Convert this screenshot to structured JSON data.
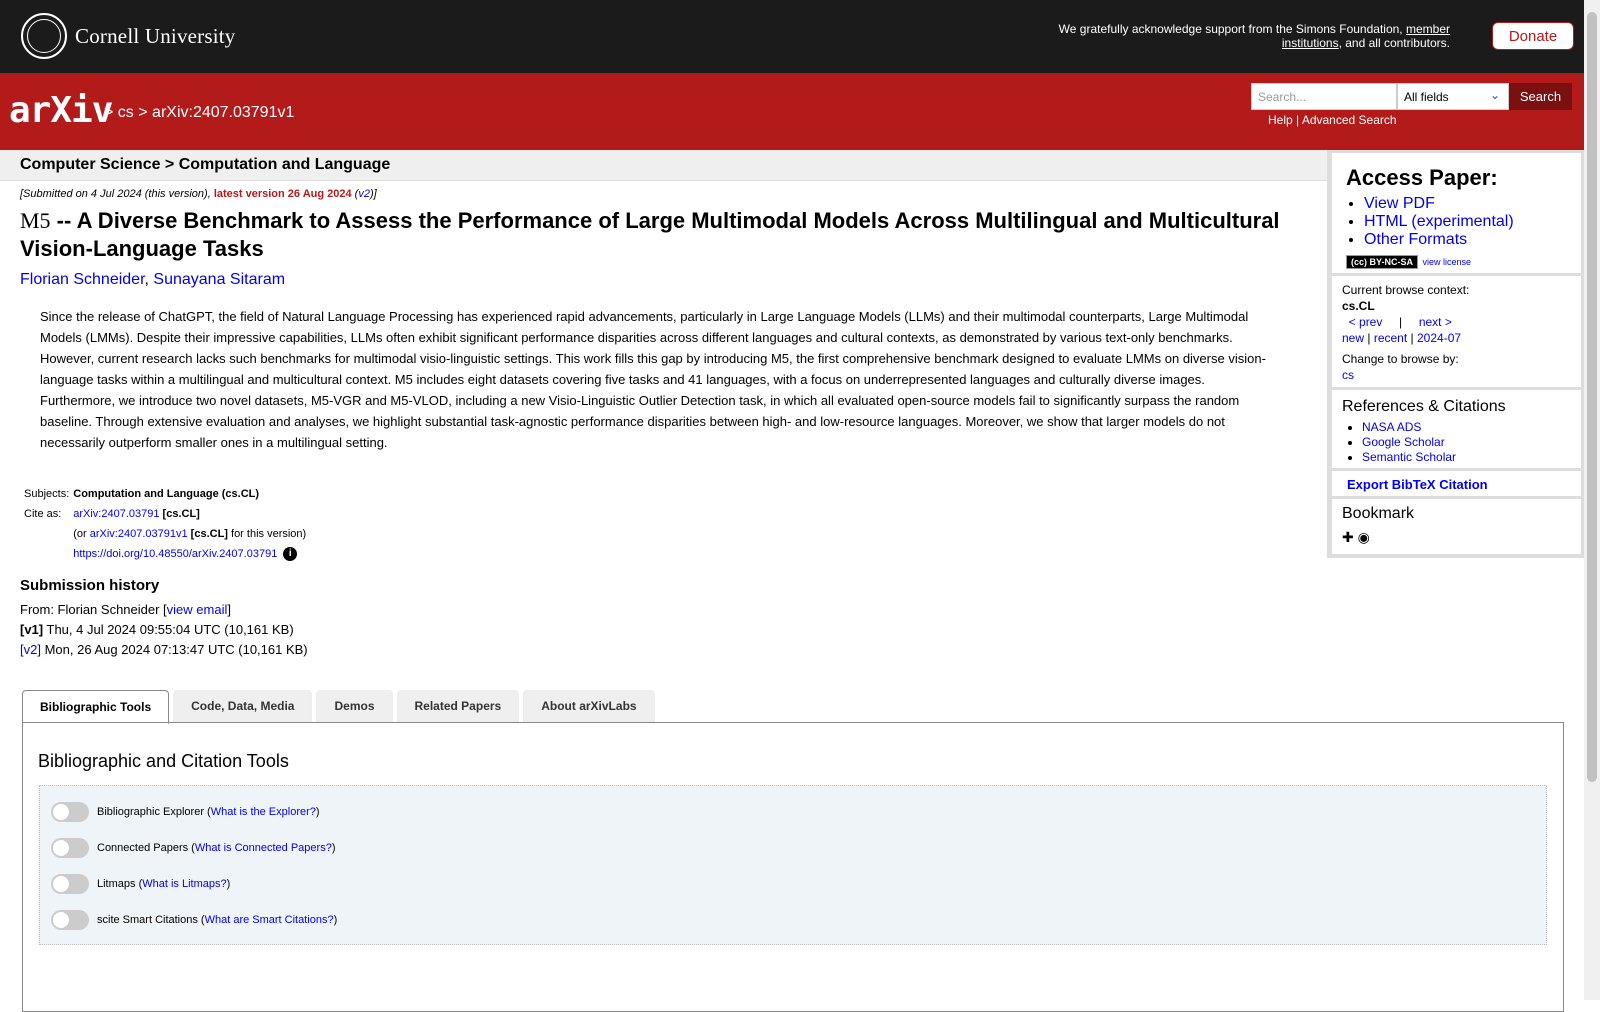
{
  "header": {
    "university": "Cornell University",
    "ack_text": "We gratefully acknowledge support from the Simons Foundation,",
    "ack_link": "member institutions",
    "ack_tail": ", and all contributors.",
    "donate": "Donate"
  },
  "nav": {
    "logo": "arXiv",
    "crumb_sep": ">",
    "crumb_cs": "cs",
    "crumb_id": "arXiv:2407.03791v1",
    "search_placeholder": "Search...",
    "field_select": "All fields",
    "search_button": "Search",
    "help": "Help",
    "advanced": "Advanced Search"
  },
  "subject_header": "Computer Science > Computation and Language",
  "paper": {
    "submitted": "[Submitted on 4 Jul 2024 (this version), ",
    "latest": "latest version 26 Aug 2024",
    "v2_open": " (",
    "v2": "v2",
    "v2_close": ")]",
    "title_m5": "M5",
    "title_rest": " -- A Diverse Benchmark to Assess the Performance of Large Multimodal Models Across Multilingual and Multicultural Vision-Language Tasks",
    "author1": "Florian Schneider",
    "author_sep": ", ",
    "author2": "Sunayana Sitaram",
    "abstract": "Since the release of ChatGPT, the field of Natural Language Processing has experienced rapid advancements, particularly in Large Language Models (LLMs) and their multimodal counterparts, Large Multimodal Models (LMMs). Despite their impressive capabilities, LLMs often exhibit significant performance disparities across different languages and cultural contexts, as demonstrated by various text-only benchmarks. However, current research lacks such benchmarks for multimodal visio-linguistic settings. This work fills this gap by introducing M5, the first comprehensive benchmark designed to evaluate LMMs on diverse vision-language tasks within a multilingual and multicultural context. M5 includes eight datasets covering five tasks and 41 languages, with a focus on underrepresented languages and culturally diverse images. Furthermore, we introduce two novel datasets, M5-VGR and M5-VLOD, including a new Visio-Linguistic Outlier Detection task, in which all evaluated open-source models fail to significantly surpass the random baseline. Through extensive evaluation and analyses, we highlight substantial task-agnostic performance disparities between high- and low-resource languages. Moreover, we show that larger models do not necessarily outperform smaller ones in a multilingual setting."
  },
  "meta": {
    "subjects_label": "Subjects:",
    "subjects_value": "Computation and Language (cs.CL)",
    "cite_label": "Cite as:",
    "cite_id": "arXiv:2407.03791",
    "cite_tag": " [cs.CL]",
    "or_open": "(or ",
    "cite_id_v1": "arXiv:2407.03791v1",
    "or_tag": " [cs.CL]",
    "or_close": " for this version)",
    "doi": "https://doi.org/10.48550/arXiv.2407.03791",
    "info": "i"
  },
  "history": {
    "title": "Submission history",
    "from_label": "From: Florian Schneider [",
    "view_email": "view email",
    "from_close": "]",
    "v1": "[v1]",
    "v1_date": " Thu, 4 Jul 2024 09:55:04 UTC (10,161 KB)",
    "v2": "[v2]",
    "v2_date": " Mon, 26 Aug 2024 07:13:47 UTC (10,161 KB)"
  },
  "sidebar": {
    "access_title": "Access Paper:",
    "view_pdf": "View PDF",
    "html": "HTML (experimental)",
    "other": "Other Formats",
    "license_badge": "(cc) BY-NC-SA",
    "view_license": "view license",
    "browse_context": "Current browse context:",
    "context": "cs.CL",
    "prev": "< prev",
    "sep": "|",
    "next": "next >",
    "new": "new",
    "recent": "recent",
    "month": "2024-07",
    "change_browse": "Change to browse by:",
    "cs": "cs",
    "refs_title": "References & Citations",
    "nasa": "NASA ADS",
    "google": "Google Scholar",
    "semantic": "Semantic Scholar",
    "bibtex": "Export BibTeX Citation",
    "bookmark": "Bookmark"
  },
  "tabs": [
    "Bibliographic Tools",
    "Code, Data, Media",
    "Demos",
    "Related Papers",
    "About arXivLabs"
  ],
  "tools": {
    "title": "Bibliographic and Citation Tools",
    "rows": [
      {
        "label": "Bibliographic Explorer (",
        "link": "What is the Explorer?",
        "close": ")"
      },
      {
        "label": "Connected Papers (",
        "link": "What is Connected Papers?",
        "close": ")"
      },
      {
        "label": "Litmaps (",
        "link": "What is Litmaps?",
        "close": ")"
      },
      {
        "label": "scite Smart Citations (",
        "link": "What are Smart Citations?",
        "close": ")"
      }
    ]
  }
}
